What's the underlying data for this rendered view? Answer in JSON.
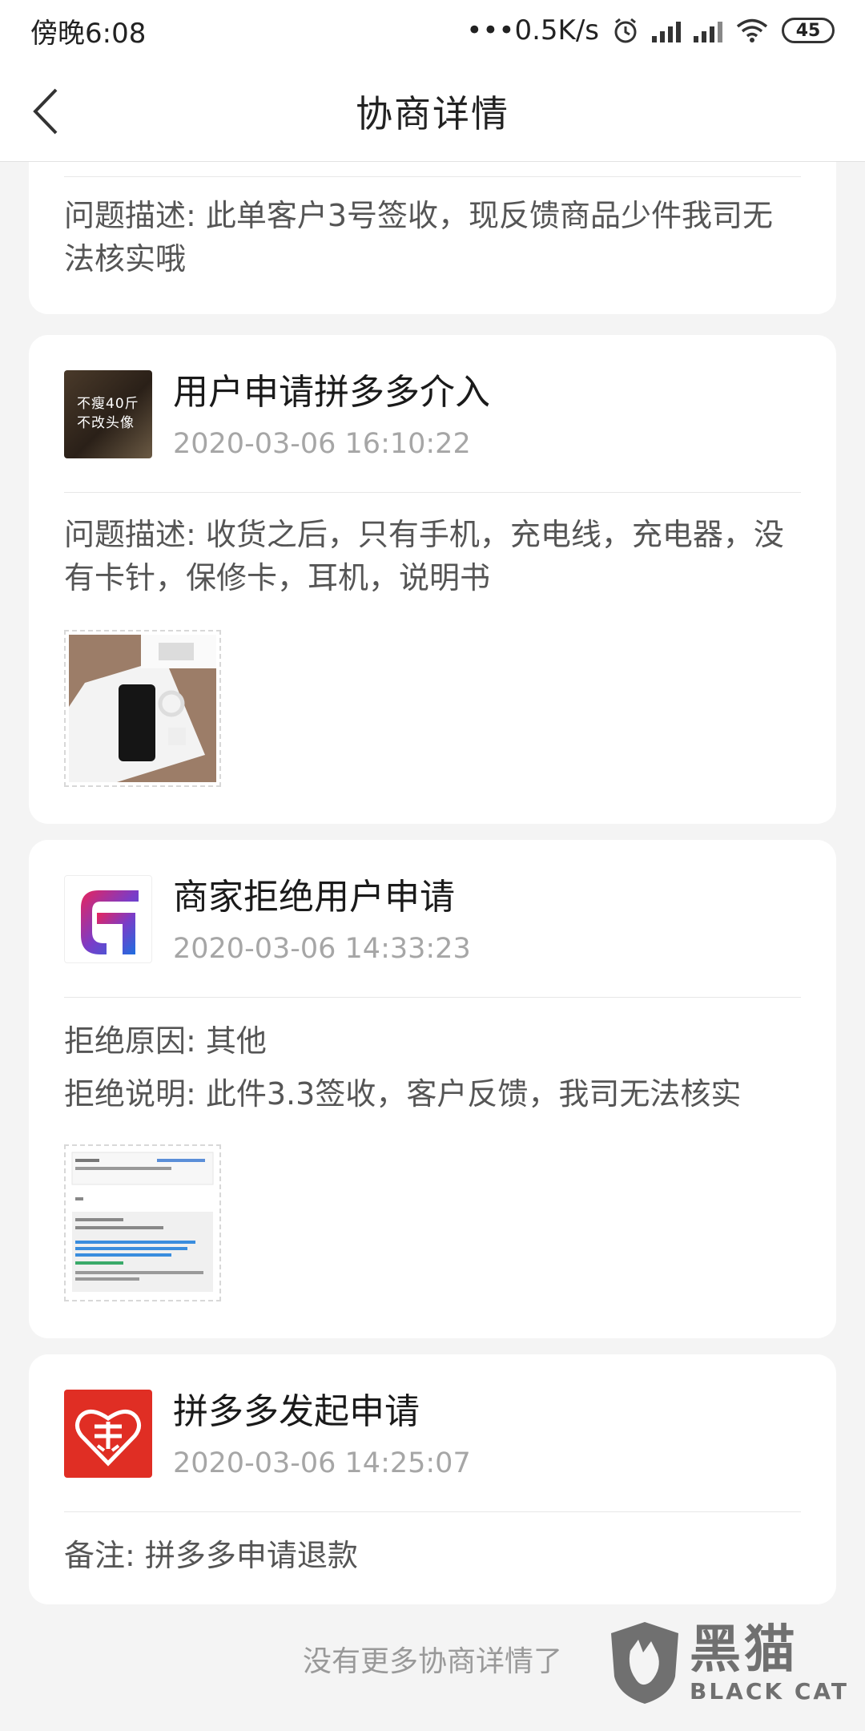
{
  "status_bar": {
    "time": "傍晚6:08",
    "network_speed": "•••0.5K/s",
    "battery": "45",
    "icons": [
      "alarm-icon",
      "signal-icon",
      "signal-icon",
      "wifi-icon",
      "battery-icon"
    ]
  },
  "header": {
    "title": "协商详情",
    "back_icon": "chevron-left-icon"
  },
  "cards": [
    {
      "description": "问题描述: 此单客户3号签收，现反馈商品少件我司无法核实哦"
    },
    {
      "avatar_text": [
        "不瘦40斤",
        "不改头像"
      ],
      "title": "用户申请拼多多介入",
      "time": "2020-03-06 16:10:22",
      "description": "问题描述: 收货之后，只有手机，充电线，充电器，没有卡针，保修卡，耳机，说明书"
    },
    {
      "title": "商家拒绝用户申请",
      "time": "2020-03-06 14:33:23",
      "reason": "拒绝原因: 其他",
      "explain": "拒绝说明: 此件3.3签收，客户反馈，我司无法核实"
    },
    {
      "title": "拼多多发起申请",
      "time": "2020-03-06 14:25:07",
      "remark": "备注: 拼多多申请退款"
    }
  ],
  "footer": "没有更多协商详情了",
  "watermark": {
    "cn": "黑猫",
    "en": "BLACK CAT"
  },
  "colors": {
    "pdd_red": "#e02e24",
    "background": "#f4f4f4"
  }
}
